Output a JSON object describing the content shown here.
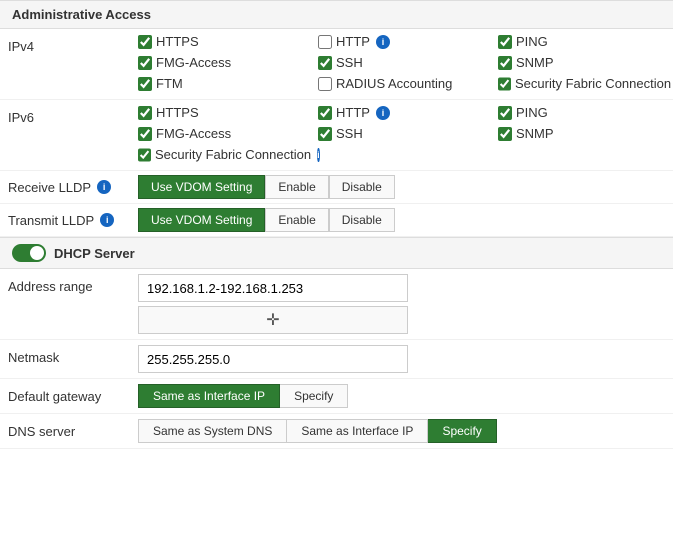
{
  "sections": {
    "admin_access": {
      "title": "Administrative Access",
      "ipv4": {
        "label": "IPv4",
        "checkboxes": [
          {
            "id": "https4",
            "label": "HTTPS",
            "checked": true,
            "info": false
          },
          {
            "id": "http4",
            "label": "HTTP",
            "checked": false,
            "info": true
          },
          {
            "id": "ping4",
            "label": "PING",
            "checked": true,
            "info": false
          },
          {
            "id": "fmg4",
            "label": "FMG-Access",
            "checked": true,
            "info": false
          },
          {
            "id": "ssh4",
            "label": "SSH",
            "checked": true,
            "info": false
          },
          {
            "id": "snmp4",
            "label": "SNMP",
            "checked": true,
            "info": false
          },
          {
            "id": "ftm4",
            "label": "FTM",
            "checked": true,
            "info": false
          },
          {
            "id": "radius4",
            "label": "RADIUS Accounting",
            "checked": false,
            "info": false
          },
          {
            "id": "secfab4",
            "label": "Security Fabric Connection",
            "checked": true,
            "info": true
          }
        ]
      },
      "ipv6": {
        "label": "IPv6",
        "checkboxes": [
          {
            "id": "https6",
            "label": "HTTPS",
            "checked": true,
            "info": false
          },
          {
            "id": "http6",
            "label": "HTTP",
            "checked": true,
            "info": true
          },
          {
            "id": "ping6",
            "label": "PING",
            "checked": true,
            "info": false
          },
          {
            "id": "fmg6",
            "label": "FMG-Access",
            "checked": true,
            "info": false
          },
          {
            "id": "ssh6",
            "label": "SSH",
            "checked": true,
            "info": false
          },
          {
            "id": "snmp6",
            "label": "SNMP",
            "checked": true,
            "info": false
          },
          {
            "id": "secfab6",
            "label": "Security Fabric Connection",
            "checked": true,
            "info": true
          }
        ]
      }
    },
    "lldp": {
      "receive": {
        "label": "Receive LLDP",
        "has_info": true,
        "active": "vdom",
        "buttons": [
          "Use VDOM Setting",
          "Enable",
          "Disable"
        ]
      },
      "transmit": {
        "label": "Transmit LLDP",
        "has_info": true,
        "active": "vdom",
        "buttons": [
          "Use VDOM Setting",
          "Enable",
          "Disable"
        ]
      }
    },
    "dhcp": {
      "title": "DHCP Server",
      "enabled": true,
      "address_range": {
        "label": "Address range",
        "value": "192.168.1.2-192.168.1.253",
        "add_button": "+"
      },
      "netmask": {
        "label": "Netmask",
        "value": "255.255.255.0"
      },
      "default_gateway": {
        "label": "Default gateway",
        "options": [
          "Same as Interface IP",
          "Specify"
        ],
        "active": "Same as Interface IP"
      },
      "dns_server": {
        "label": "DNS server",
        "options": [
          "Same as System DNS",
          "Same as Interface IP",
          "Specify"
        ],
        "active": "Specify"
      }
    }
  }
}
